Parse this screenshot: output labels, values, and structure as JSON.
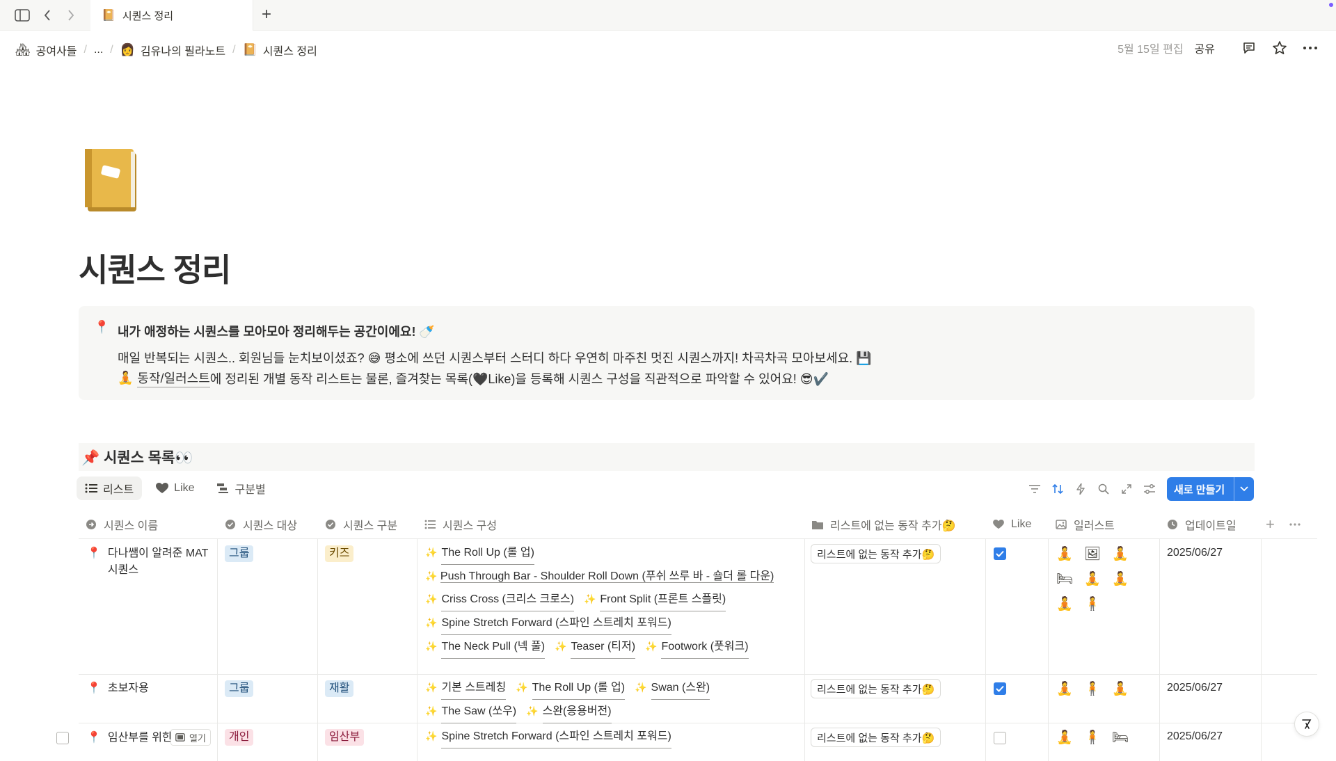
{
  "tab": {
    "icon": "📔",
    "title": "시퀀스 정리"
  },
  "breadcrumb": [
    {
      "icon": "🏘",
      "label": "공여사들"
    },
    {
      "icon": "",
      "label": "..."
    },
    {
      "icon": "👩",
      "label": "김유나의 필라노트"
    },
    {
      "icon": "📔",
      "label": "시퀀스 정리"
    }
  ],
  "topbar": {
    "edited": "5월 15일 편집",
    "share": "공유"
  },
  "page": {
    "icon": "📔",
    "title": "시퀀스 정리"
  },
  "callout": {
    "icon": "📍",
    "heading": "내가 애정하는 시퀀스를 모아모아 정리해두는 공간이에요! 🍼",
    "line1": "매일 반복되는 시퀀스.. 회원님들 눈치보이셨죠? 😅 평소에 쓰던 시퀀스부터 스터디 하다 우연히 마주친 멋진 시퀀스까지! 차곡차곡 모아보세요. 💾",
    "line2_icon": "🧘",
    "line2_link": "동작/일러스트",
    "line2_rest": "에 정리된 개별 동작 리스트는 물론, 즐겨찾는 목록(🖤Like)을 등록해 시퀀스 구성을 직관적으로 파악할 수 있어요! 😎✔️"
  },
  "section": {
    "title": "📌 시퀀스 목록👀"
  },
  "views": [
    {
      "label": "리스트",
      "icon": "list-icon",
      "active": true
    },
    {
      "label": "Like",
      "icon": "heart-icon",
      "active": false
    },
    {
      "label": "구분별",
      "icon": "board-icon",
      "active": false
    }
  ],
  "new_button": "새로 만들기",
  "columns": [
    {
      "label": "시퀀스 이름",
      "icon": "relation-icon"
    },
    {
      "label": "시퀀스 대상",
      "icon": "status-icon"
    },
    {
      "label": "시퀀스 구분",
      "icon": "status-icon"
    },
    {
      "label": "시퀀스 구성",
      "icon": "list-icon"
    },
    {
      "label": "리스트에 없는 동작 추가🤔",
      "icon": "folder-icon"
    },
    {
      "label": "Like",
      "icon": "heart-icon"
    },
    {
      "label": "일러스트",
      "icon": "image-icon"
    },
    {
      "label": "업데이트일",
      "icon": "clock-icon"
    }
  ],
  "rows": [
    {
      "name": "다나쌤이 알려준 MAT 시퀀스",
      "target": "그룹",
      "target_color": "blue",
      "category": "키즈",
      "category_color": "yellow",
      "sequence": [
        "The Roll Up (롤 업)",
        "Push Through Bar - Shoulder Roll Down (푸쉬 쓰루 바 - 숄더 롤 다운)",
        "Criss Cross (크리스 크로스)",
        "Front Split (프론트 스플릿)",
        "Spine Stretch Forward (스파인 스트레치 포워드)",
        "The Neck Pull (넥 풀)",
        "Teaser (티저)",
        "Footwork (풋워크)"
      ],
      "add": "리스트에 없는 동작 추가🤔",
      "like": true,
      "illustrations": [
        "🧘",
        "🖼",
        "🧘",
        "🛏",
        "🧘",
        "🧘",
        "🧘",
        "🧍"
      ],
      "updated": "2025/06/27"
    },
    {
      "name": "초보자용",
      "target": "그룹",
      "target_color": "blue",
      "category": "재활",
      "category_color": "blue",
      "sequence": [
        "기본 스트레칭",
        "The Roll Up (롤 업)",
        "Swan (스완)",
        "The Saw (쏘우)",
        "스완(응용버전)"
      ],
      "add": "리스트에 없는 동작 추가🤔",
      "like": true,
      "illustrations": [
        "🧘",
        "🧍",
        "🧘"
      ],
      "updated": "2025/06/27"
    },
    {
      "name": "임산부를 위한",
      "open_label": "열기",
      "target": "개인",
      "target_color": "pink",
      "category": "임산부",
      "category_color": "pink",
      "sequence": [
        "Spine Stretch Forward (스파인 스트레치 포워드)"
      ],
      "add": "리스트에 없는 동작 추가🤔",
      "like": false,
      "illustrations": [
        "🧘",
        "🧍",
        "🛏"
      ],
      "updated": "2025/06/27"
    }
  ],
  "colors": {
    "accent": "#2f7ee8",
    "text": "#37352f",
    "muted": "#9b9a97"
  }
}
